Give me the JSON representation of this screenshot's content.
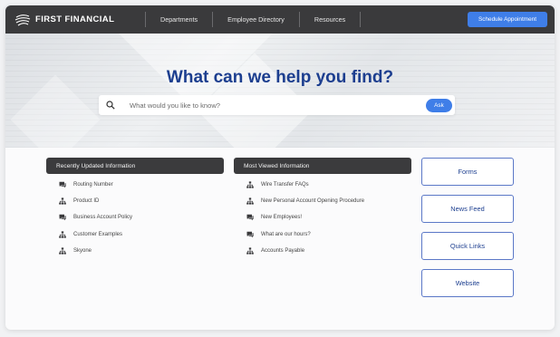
{
  "header": {
    "brand": "FIRST FINANCIAL",
    "nav": [
      "Departments",
      "Employee Directory",
      "Resources"
    ],
    "cta_label": "Schedule Appointment"
  },
  "hero": {
    "title": "What can we help you find?",
    "search_placeholder": "What would you like to know?",
    "ask_label": "Ask"
  },
  "recent": {
    "title": "Recently Updated Information",
    "items": [
      {
        "label": "Routing Number",
        "icon": "chat-icon"
      },
      {
        "label": "Product ID",
        "icon": "sitemap-icon"
      },
      {
        "label": "Business Account Policy",
        "icon": "chat-icon"
      },
      {
        "label": "Customer Examples",
        "icon": "sitemap-icon"
      },
      {
        "label": "Skyone",
        "icon": "sitemap-icon"
      }
    ]
  },
  "viewed": {
    "title": "Most Viewed Information",
    "items": [
      {
        "label": "Wire Transfer FAQs",
        "icon": "sitemap-icon"
      },
      {
        "label": "New Personal Account Opening Procedure",
        "icon": "sitemap-icon"
      },
      {
        "label": "New Employees!",
        "icon": "chat-icon"
      },
      {
        "label": "What are our hours?",
        "icon": "chat-icon"
      },
      {
        "label": "Accounts Payable",
        "icon": "sitemap-icon"
      }
    ]
  },
  "quick_buttons": [
    "Forms",
    "News Feed",
    "Quick Links",
    "Website"
  ],
  "colors": {
    "accent": "#3f7ee8",
    "title": "#1c3e8f",
    "dark_bar": "#3a3a3c"
  }
}
